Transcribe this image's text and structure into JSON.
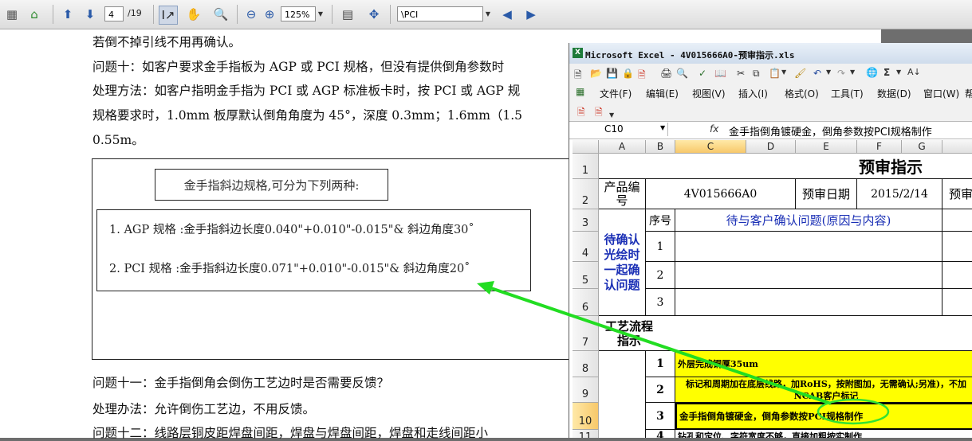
{
  "pdf_toolbar": {
    "page_current": "4",
    "page_total": "/19",
    "zoom": "125%",
    "search_value": "\\PCI"
  },
  "pdf": {
    "lines_top": [
      "若倒不掉引线不用再确认。",
      "问题十：如客户要求金手指板为 AGP 或 PCI 规格，但没有提供倒角参数时",
      "处理方法：如客户指明金手指为 PCI 或 AGP 标准板卡时，按 PCI 或 AGP 规",
      "规格要求时，1.0mm 板厚默认倒角角度为 45°，深度 0.3mm；1.6mm（1.5",
      "0.55m。"
    ],
    "spec_heading": "金手指斜边规格,可分为下列两种:",
    "spec_agp": "1. AGP 规格 :金手指斜边长度0.040\"+0.010\"-0.015\"& 斜边角度30˚",
    "spec_pci": "2.  PCI 规格 :金手指斜边长度0.071\"+0.010\"-0.015\"& 斜边角度20˚",
    "lines_bottom": [
      "问题十一：金手指倒角会倒伤工艺边时是否需要反馈？",
      "处理办法：允许倒伤工艺边，不用反馈。",
      "问题十二：线路层铜皮距焊盘间距，焊盘与焊盘间距，焊盘和走线间距小"
    ]
  },
  "excel": {
    "title": "Microsoft Excel - 4V015666A0-预审指示.xls",
    "menu": [
      "文件(F)",
      "编辑(E)",
      "视图(V)",
      "插入(I)",
      "格式(O)",
      "工具(T)",
      "数据(D)",
      "窗口(W)",
      "帮"
    ],
    "name_box": "C10",
    "formula_icon": "fx",
    "formula": "金手指倒角镀硬金，倒角参数按PCI规格制作",
    "columns": [
      "A",
      "B",
      "C",
      "D",
      "E",
      "F",
      "G"
    ],
    "rows": [
      "1",
      "2",
      "3",
      "4",
      "5",
      "6",
      "7",
      "8",
      "9",
      "10",
      "11"
    ],
    "sheet": {
      "title": "预审指示",
      "product_label": "产品编号",
      "product_no": "4V015666A0",
      "date_label": "预审日期",
      "date": "2015/2/14",
      "reviewer_label": "预审",
      "seq_label": "序号",
      "issue_header": "待与客户确认问题(原因与内容)",
      "confirm_label": "待确认光绘时一起确认问题",
      "seq": [
        "1",
        "2",
        "3"
      ],
      "process_label": "工艺流程指示",
      "steps": [
        {
          "no": "1",
          "text": "外层完成铜厚35um"
        },
        {
          "no": "2",
          "text": "标记和周期加在底层线路，加RoHS，按附图加，无需确认;另准)，不加NCAB客户标记"
        },
        {
          "no": "3",
          "text": "金手指倒角镀硬金，倒角参数按PCI规格制作"
        },
        {
          "no": "4",
          "text": "钻孔和定位、字符宽度不够，直接加粗按实制作"
        }
      ]
    }
  },
  "colors": {
    "arrow": "#22dd22",
    "highlight": "#ffff00",
    "blue_text": "#1a2fb5"
  }
}
